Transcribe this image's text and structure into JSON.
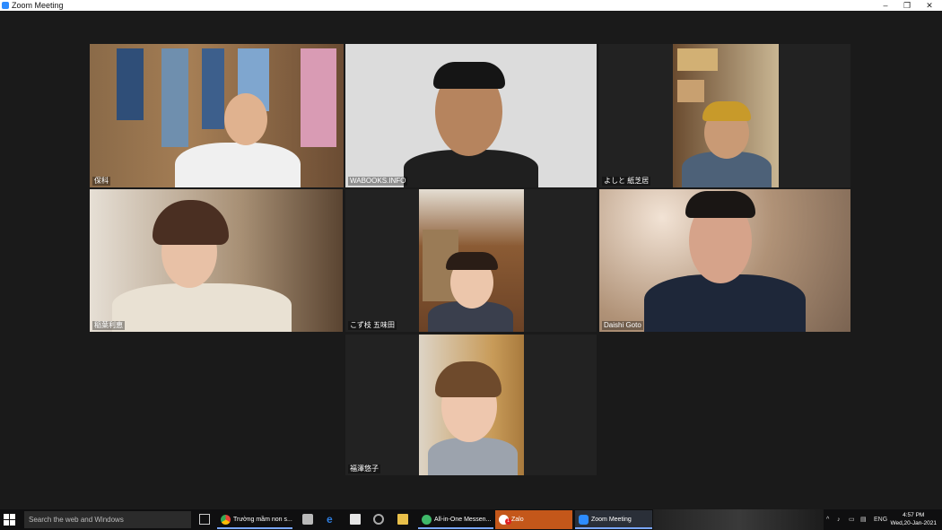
{
  "window": {
    "title": "Zoom Meeting",
    "minimize": "–",
    "restore": "❐",
    "close": "✕"
  },
  "participants": [
    {
      "name": "保科"
    },
    {
      "name": "WABOOKS.INFO"
    },
    {
      "name": "よしと 紙芝居"
    },
    {
      "name": "稲葉利恵"
    },
    {
      "name": "こず枝 五味田"
    },
    {
      "name": "Daishi Goto"
    },
    {
      "name": "福澤悠子"
    }
  ],
  "taskbar": {
    "search_placeholder": "Search the web and Windows",
    "apps": [
      {
        "label": "Trường mầm non s..."
      },
      {
        "label": "All-in-One Messen..."
      },
      {
        "label": "Zalo",
        "badge": "1"
      },
      {
        "label": "Zoom Meeting"
      }
    ],
    "language": "ENG",
    "time": "4:57 PM",
    "date": "Wed,20-Jan-2021"
  },
  "colors": {
    "active_speaker": "#c8e832",
    "zoom_blue": "#2d8cff",
    "zalo_active": "#c4571a"
  }
}
